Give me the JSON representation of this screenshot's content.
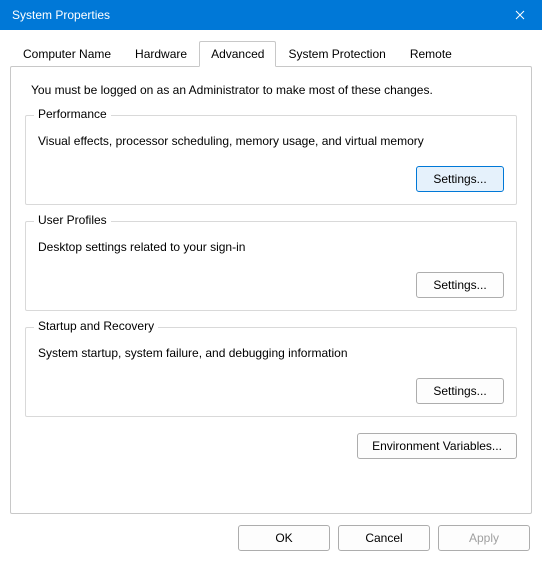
{
  "window": {
    "title": "System Properties"
  },
  "tabs": {
    "computer_name": "Computer Name",
    "hardware": "Hardware",
    "advanced": "Advanced",
    "system_protection": "System Protection",
    "remote": "Remote"
  },
  "admin_note": "You must be logged on as an Administrator to make most of these changes.",
  "groups": {
    "performance": {
      "title": "Performance",
      "desc": "Visual effects, processor scheduling, memory usage, and virtual memory",
      "button": "Settings..."
    },
    "user_profiles": {
      "title": "User Profiles",
      "desc": "Desktop settings related to your sign-in",
      "button": "Settings..."
    },
    "startup": {
      "title": "Startup and Recovery",
      "desc": "System startup, system failure, and debugging information",
      "button": "Settings..."
    }
  },
  "env_button": "Environment Variables...",
  "bottom": {
    "ok": "OK",
    "cancel": "Cancel",
    "apply": "Apply"
  }
}
